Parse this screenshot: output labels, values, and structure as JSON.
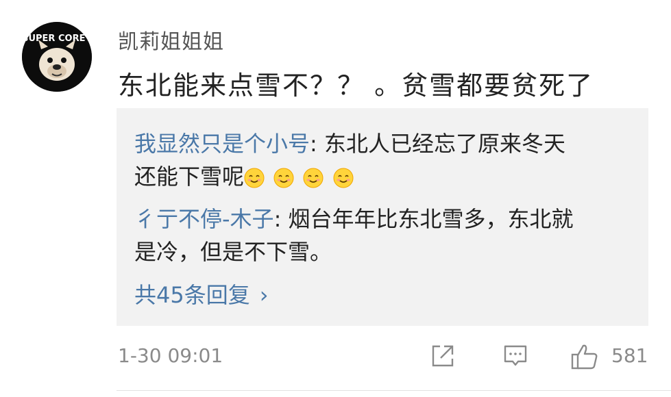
{
  "comment": {
    "avatar_icon": "bulldog-avatar-icon",
    "avatar_text": "SUPER COREY",
    "username": "凯莉姐姐姐",
    "text": "东北能来点雪不？？ 。贫雪都要贫死了",
    "timestamp": "1-30 09:01",
    "like_count": "581"
  },
  "replies": [
    {
      "name": "我显然只是个小号",
      "separator": ": ",
      "line1": "东北人已经忘了原来冬天",
      "line2": "还能下雪呢",
      "emoji_icons": [
        "smile-emoji-icon",
        "smile-emoji-icon",
        "smile-emoji-icon",
        "smile-emoji-icon"
      ]
    },
    {
      "name": "彳亍不停-木子",
      "separator": ": ",
      "line1": "烟台年年比东北雪多，东北就",
      "line2": "是冷，但是不下雪。"
    }
  ],
  "more_replies": {
    "label": "共45条回复",
    "chevron": "›"
  },
  "actions": {
    "share_icon": "share-icon",
    "reply_icon": "comment-icon",
    "like_icon": "thumbs-up-icon"
  },
  "colors": {
    "link": "#4a78a8",
    "text": "#222222",
    "muted": "#8a8a8a",
    "reply_bg": "#f2f2f2"
  }
}
